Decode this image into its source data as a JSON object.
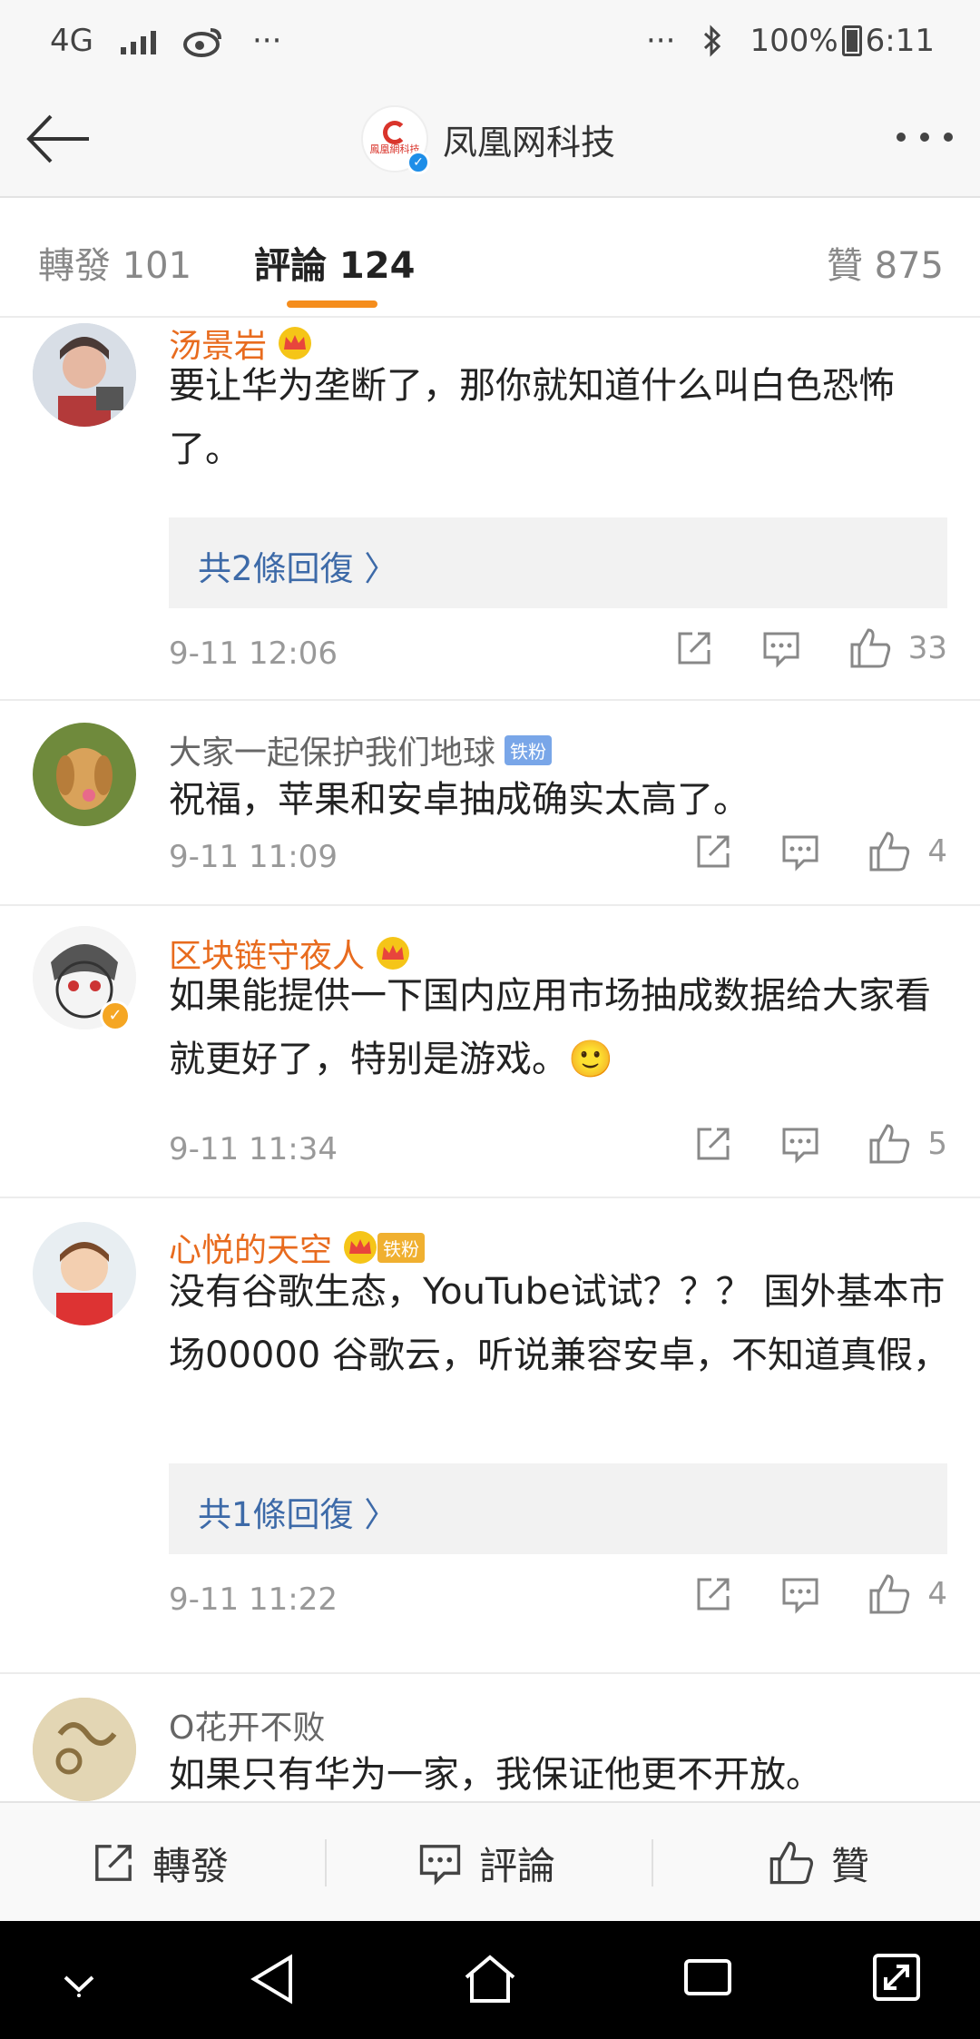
{
  "status_bar": {
    "network": "4G",
    "dots_left": "···",
    "dots_right": "···",
    "battery": "100%",
    "time": "6:11"
  },
  "header": {
    "account_name": "凤凰网科技",
    "logo_text": "鳳凰網科技"
  },
  "tabs": {
    "repost": "轉發 101",
    "comment": "評論 124",
    "like": "贊 875"
  },
  "comments": [
    {
      "user": "汤景岩",
      "text": "要让华为垄断了，那你就知道什么叫白色恐怖了。",
      "replies": "共2條回復 〉",
      "time": "9-11 12:06",
      "likes": "33"
    },
    {
      "user": "大家一起保护我们地球",
      "badge": "铁粉",
      "text": "祝福，苹果和安卓抽成确实太高了。",
      "time": "9-11 11:09",
      "likes": "4"
    },
    {
      "user": "区块链守夜人",
      "text": "如果能提供一下国内应用市场抽成数据给大家看就更好了，特别是游戏。🙂",
      "time": "9-11 11:34",
      "likes": "5"
    },
    {
      "user": "心悦的天空",
      "badge": "铁粉",
      "text": "没有谷歌生态，YouTube试试？？？ 国外基本市场00000   谷歌云，听说兼容安卓，不知道真假，",
      "replies": "共1條回復 〉",
      "time": "9-11 11:22",
      "likes": "4"
    },
    {
      "user": "O花开不败",
      "text": "如果只有华为一家，我保证他更不开放。"
    }
  ],
  "toolbar": {
    "repost": "轉發",
    "comment": "評論",
    "like": "贊"
  }
}
